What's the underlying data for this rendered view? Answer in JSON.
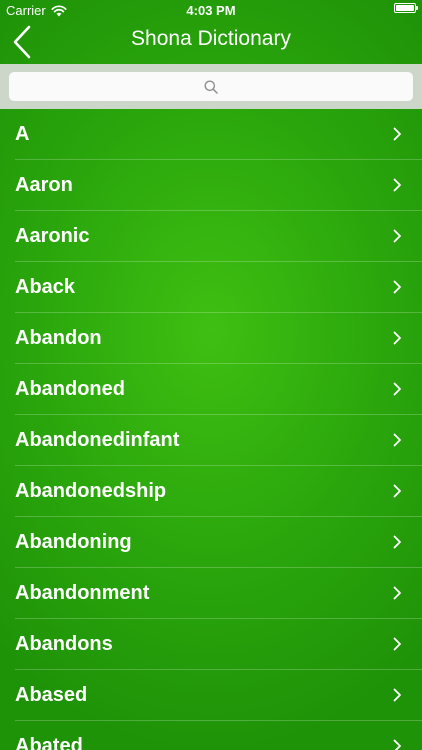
{
  "status_bar": {
    "carrier": "Carrier",
    "time": "4:03 PM",
    "battery_level": 1.0,
    "icons": [
      "wifi-icon",
      "battery-icon"
    ]
  },
  "nav": {
    "title": "Shona Dictionary",
    "back_icon": "chevron-left-icon"
  },
  "search": {
    "value": "",
    "placeholder": "",
    "icon": "search-icon"
  },
  "list": {
    "items": [
      "A",
      "Aaron",
      "Aaronic",
      "Aback",
      "Abandon",
      "Abandoned",
      "Abandonedinfant",
      "Abandonedship",
      "Abandoning",
      "Abandonment",
      "Abandons",
      "Abased",
      "Abated"
    ],
    "chevron_icon": "chevron-right-icon"
  },
  "colors": {
    "background": "#2aa60c",
    "search_bar": "#ccd6c9",
    "text": "#ffffff"
  }
}
